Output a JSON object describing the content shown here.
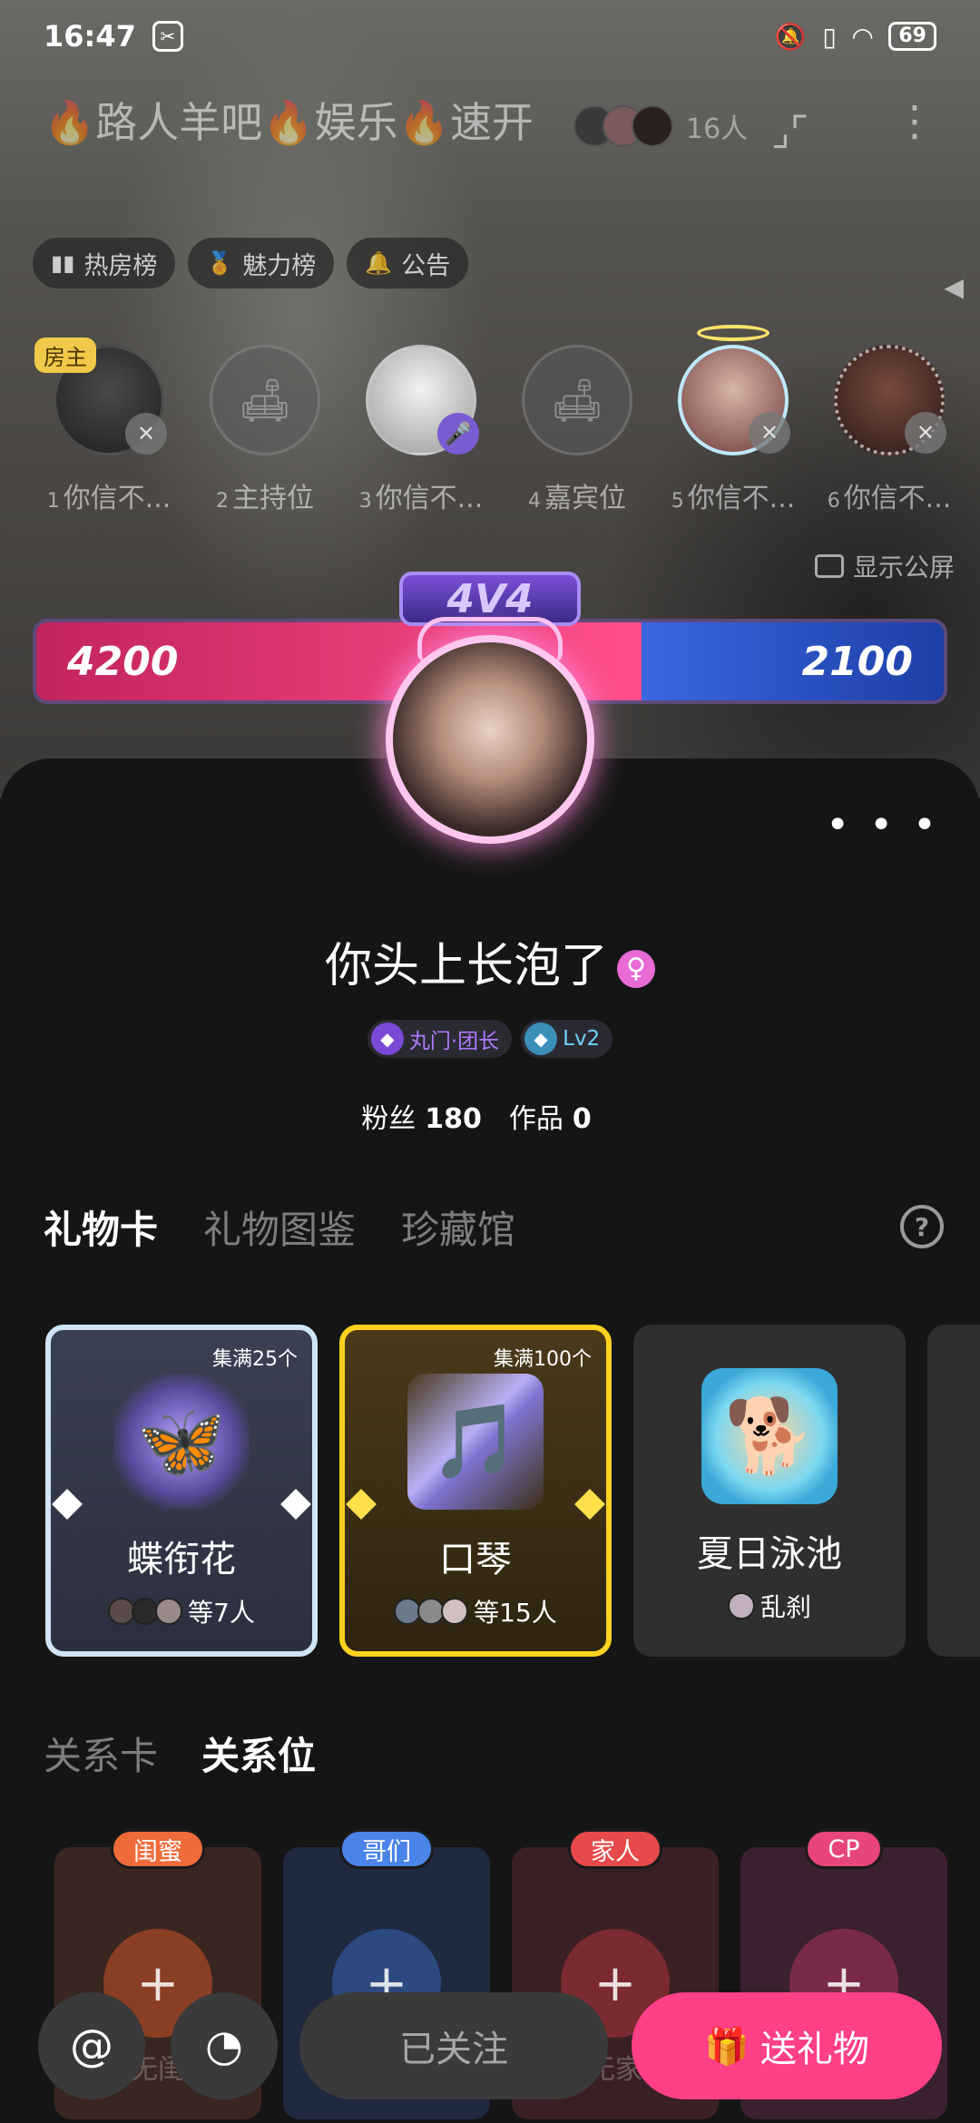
{
  "status_bar": {
    "time": "16:47",
    "battery": "69"
  },
  "room": {
    "title": "🔥路人羊吧🔥娱乐🔥速开",
    "user_count": "16人",
    "chips": [
      {
        "label": "热房榜",
        "icon": "bar-chart-icon"
      },
      {
        "label": "魅力榜",
        "icon": "charm-medal-icon"
      },
      {
        "label": "公告",
        "icon": "bell-icon"
      }
    ],
    "owner_tag": "房主",
    "seats": [
      {
        "num": "1",
        "label": "你信不...",
        "type": "user"
      },
      {
        "num": "2",
        "label": "主持位",
        "type": "empty"
      },
      {
        "num": "3",
        "label": "你信不...",
        "type": "user"
      },
      {
        "num": "4",
        "label": "嘉宾位",
        "type": "empty"
      },
      {
        "num": "5",
        "label": "你信不...",
        "type": "user"
      },
      {
        "num": "6",
        "label": "你信不...",
        "type": "user"
      }
    ],
    "public_screen": "显示公屏",
    "pk": {
      "mode": "4V4",
      "left_score": "4200",
      "right_score": "2100",
      "left_fraction": 0.667
    }
  },
  "profile": {
    "more": "• • •",
    "nickname": "你头上长泡了",
    "gender_symbol": "♀",
    "badges": [
      {
        "label": "丸门·团长",
        "icon": "group-badge-icon"
      },
      {
        "label": "Lv2",
        "icon": "level-badge-icon"
      }
    ],
    "stats": {
      "fans_label": "粉丝",
      "fans_value": "180",
      "works_label": "作品",
      "works_value": "0"
    }
  },
  "gift_tabs": {
    "items": [
      "礼物卡",
      "礼物图鉴",
      "珍藏馆"
    ],
    "active": 0,
    "help": "?"
  },
  "gift_cards": [
    {
      "count": "集满25个",
      "name": "蝶衔花",
      "sub": "等7人",
      "style": "silver",
      "icon": "butterfly-flower-icon"
    },
    {
      "count": "集满100个",
      "name": "口琴",
      "sub": "等15人",
      "style": "gold",
      "icon": "harmonica-icon"
    },
    {
      "count": "",
      "name": "夏日泳池",
      "sub": "乱刹",
      "style": "plain",
      "icon": "summer-pool-icon"
    }
  ],
  "relation_tabs": {
    "items": [
      "关系卡",
      "关系位"
    ],
    "active": 1
  },
  "relation_slots": [
    {
      "tag": "闺蜜",
      "faded": "无闺",
      "style": "bestie"
    },
    {
      "tag": "哥们",
      "faded": "",
      "style": "bro"
    },
    {
      "tag": "家人",
      "faded": "无家",
      "style": "family"
    },
    {
      "tag": "CP",
      "faded": "",
      "style": "cp"
    }
  ],
  "actions": {
    "at": "@",
    "follow": "已关注",
    "gift": "送礼物"
  }
}
